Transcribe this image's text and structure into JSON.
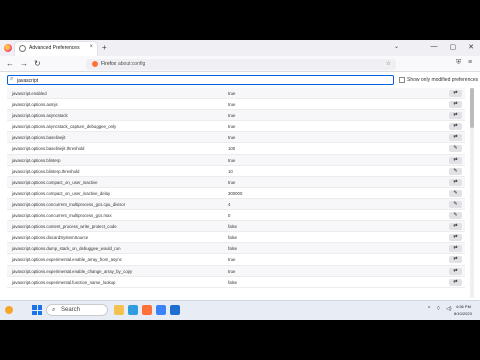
{
  "browser": {
    "tab_title": "Advanced Preferences",
    "tab_close": "×",
    "new_tab": "+",
    "tab_list": "⌄",
    "window_controls": {
      "minimize": "—",
      "maximize": "▢",
      "close": "✕"
    },
    "nav": {
      "back": "←",
      "forward": "→",
      "reload": "↻"
    },
    "url_brand": "Firefox",
    "url": "about:config",
    "bookmark_star": "☆",
    "extensions": "⛨",
    "menu": "≡"
  },
  "config": {
    "search_icon": "⌕",
    "search_value": "javascript",
    "show_modified_label": "Show only modified preferences",
    "preferences": [
      {
        "name": "javascript.enabled",
        "value": "true",
        "action": "⇄"
      },
      {
        "name": "javascript.options.asmjs",
        "value": "true",
        "action": "⇄"
      },
      {
        "name": "javascript.options.asyncstack",
        "value": "true",
        "action": "⇄"
      },
      {
        "name": "javascript.options.asyncstack_capture_debuggee_only",
        "value": "true",
        "action": "⇄"
      },
      {
        "name": "javascript.options.baselinejit",
        "value": "true",
        "action": "⇄"
      },
      {
        "name": "javascript.options.baselinejit.threshold",
        "value": "100",
        "action": "✎"
      },
      {
        "name": "javascript.options.blinterp",
        "value": "true",
        "action": "⇄"
      },
      {
        "name": "javascript.options.blinterp.threshold",
        "value": "10",
        "action": "✎"
      },
      {
        "name": "javascript.options.compact_on_user_inactive",
        "value": "true",
        "action": "⇄"
      },
      {
        "name": "javascript.options.compact_on_user_inactive_delay",
        "value": "300000",
        "action": "✎"
      },
      {
        "name": "javascript.options.concurrent_multiprocess_gcs.cpu_divisor",
        "value": "4",
        "action": "✎"
      },
      {
        "name": "javascript.options.concurrent_multiprocess_gcs.max",
        "value": "0",
        "action": "✎"
      },
      {
        "name": "javascript.options.content_process_write_protect_code",
        "value": "false",
        "action": "⇄"
      },
      {
        "name": "javascript.options.discardSystemSource",
        "value": "false",
        "action": "⇄"
      },
      {
        "name": "javascript.options.dump_stack_on_debuggee_would_run",
        "value": "false",
        "action": "⇄"
      },
      {
        "name": "javascript.options.experimental.enable_array_from_async",
        "value": "true",
        "action": "⇄"
      },
      {
        "name": "javascript.options.experimental.enable_change_array_by_copy",
        "value": "true",
        "action": "⇄"
      },
      {
        "name": "javascript.options.experimental.function_name_lookup",
        "value": "false",
        "action": "⇄"
      }
    ]
  },
  "taskbar": {
    "search_icon": "⌕",
    "search_label": "Search",
    "apps": [
      {
        "name": "taskbar-app-explorer",
        "color": "#f2c14e"
      },
      {
        "name": "taskbar-app-edge",
        "color": "#2f9de0"
      },
      {
        "name": "taskbar-app-firefox",
        "color": "#ff7139"
      },
      {
        "name": "taskbar-app-store",
        "color": "#3b82f6"
      },
      {
        "name": "taskbar-app-mail",
        "color": "#1f6fd1"
      }
    ],
    "tray": {
      "chevron": "^",
      "network": "⌔",
      "volume": "◁)"
    },
    "clock_time": "4:56 PM",
    "clock_date": "8/10/2023"
  }
}
